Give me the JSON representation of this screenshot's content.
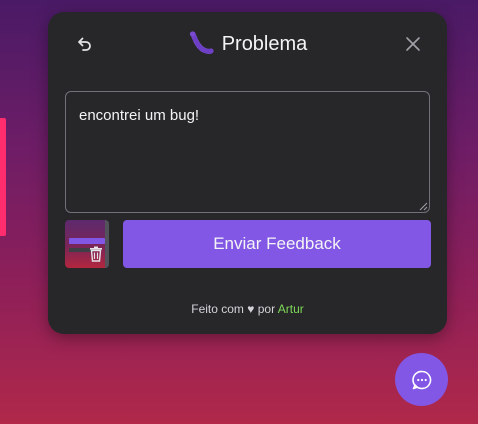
{
  "widget": {
    "title": "Problema",
    "title_icon": "bug-icon",
    "back_icon": "undo-arrow-icon",
    "close_icon": "close-icon",
    "comment_value": "encontrei um bug!",
    "screenshot_icon": "trash-icon",
    "send_label": "Enviar Feedback",
    "footer_prefix": "Feito com",
    "footer_heart": "♥",
    "footer_por": "por",
    "footer_author": "Artur"
  },
  "fab": {
    "icon": "chat-bubble-icon"
  },
  "colors": {
    "panel": "#27272a",
    "accent": "#8257e5",
    "text": "#f4f4f5",
    "author_link": "#7ed957"
  }
}
